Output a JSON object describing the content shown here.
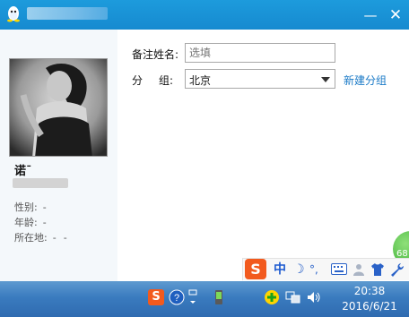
{
  "window": {
    "minimize_glyph": "—",
    "close_glyph": "✕"
  },
  "profile": {
    "nickname": "诺ˉ",
    "gender_label": "性别:",
    "gender_value": "-",
    "age_label": "年龄:",
    "age_value": "-",
    "location_label": "所在地:",
    "location_value_1": "-",
    "location_value_2": "-"
  },
  "form": {
    "remark_label": "备注姓名:",
    "remark_placeholder": "选填",
    "remark_value": "",
    "group_label_part1": "分",
    "group_label_part2": "组:",
    "group_selected": "北京",
    "new_group_link": "新建分组"
  },
  "ime_toolbar": {
    "logo": "S",
    "chinese_mode": "中",
    "moon": "☽",
    "punct": "°,"
  },
  "floating_ball": {
    "value": "68"
  },
  "taskbar": {
    "time": "20:38",
    "date": "2016/6/21"
  },
  "colors": {
    "titlebar": "#168ad0",
    "link": "#1a7ac7",
    "sogou": "#f25a1e",
    "taskbar": "#3a7bbf"
  }
}
